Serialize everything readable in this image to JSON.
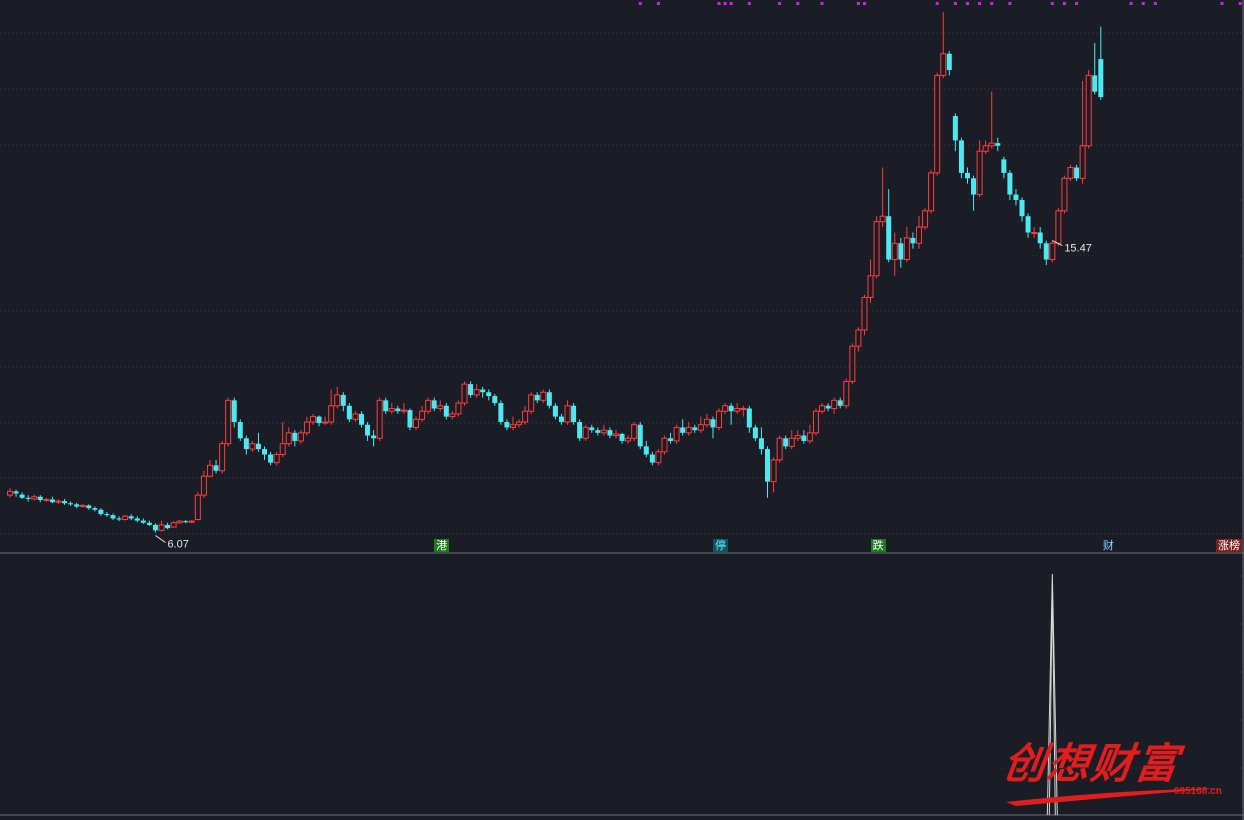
{
  "chart_data": {
    "type": "candlestick",
    "price_axis": {
      "min": 5.5,
      "max": 15.6
    },
    "labels": {
      "low_marker": "6.07",
      "high_marker": "15.47"
    },
    "annotations": [
      {
        "index": 71,
        "text": "港",
        "color": "#ffffff",
        "bg": "#1f7a1f"
      },
      {
        "index": 117,
        "text": "停",
        "color": "#6fe8ff",
        "bg": "#0f5560"
      },
      {
        "index": 143,
        "text": "跌",
        "color": "#ffffff",
        "bg": "#1f7a1f"
      },
      {
        "index": 181,
        "text": "财",
        "color": "#8ad7ff",
        "bg": "#1b1d26"
      },
      {
        "index": 200,
        "text": "涨榜",
        "color": "#ffffff",
        "bg": "#7a1f1f"
      }
    ],
    "top_markers": [
      104,
      107,
      117,
      118,
      119,
      122,
      127,
      130,
      134,
      140,
      141,
      153,
      156,
      158,
      160,
      162,
      165,
      172,
      174,
      176,
      185,
      187,
      189,
      200,
      203
    ],
    "volume_spike_index": 172,
    "colors": {
      "up": "#ff3c3c",
      "down": "#4de8f0",
      "grid": "#3a3d48",
      "marker": "#d21ff0",
      "text": "#e6e6e6",
      "volume": "#d8d8d8"
    },
    "candles": [
      [
        6.55,
        6.62,
        6.68,
        6.5
      ],
      [
        6.62,
        6.58,
        6.65,
        6.52
      ],
      [
        6.56,
        6.5,
        6.6,
        6.48
      ],
      [
        6.5,
        6.48,
        6.55,
        6.43
      ],
      [
        6.48,
        6.52,
        6.56,
        6.45
      ],
      [
        6.52,
        6.46,
        6.55,
        6.42
      ],
      [
        6.46,
        6.47,
        6.5,
        6.43
      ],
      [
        6.47,
        6.42,
        6.52,
        6.4
      ],
      [
        6.42,
        6.44,
        6.47,
        6.39
      ],
      [
        6.44,
        6.4,
        6.48,
        6.37
      ],
      [
        6.4,
        6.38,
        6.43,
        6.35
      ],
      [
        6.38,
        6.34,
        6.41,
        6.31
      ],
      [
        6.34,
        6.36,
        6.39,
        6.32
      ],
      [
        6.36,
        6.31,
        6.38,
        6.28
      ],
      [
        6.31,
        6.28,
        6.34,
        6.25
      ],
      [
        6.28,
        6.2,
        6.31,
        6.17
      ],
      [
        6.2,
        6.18,
        6.24,
        6.15
      ],
      [
        6.18,
        6.12,
        6.21,
        6.09
      ],
      [
        6.12,
        6.1,
        6.16,
        6.07
      ],
      [
        6.1,
        6.16,
        6.19,
        6.08
      ],
      [
        6.16,
        6.12,
        6.2,
        6.09
      ],
      [
        6.12,
        6.08,
        6.16,
        6.05
      ],
      [
        6.08,
        6.04,
        6.12,
        6.02
      ],
      [
        6.04,
        6.0,
        6.08,
        5.98
      ],
      [
        6.0,
        5.9,
        6.03,
        5.86
      ],
      [
        5.9,
        6.0,
        6.08,
        5.88
      ],
      [
        6.0,
        5.94,
        6.04,
        5.92
      ],
      [
        5.96,
        6.04,
        6.07,
        5.95
      ],
      [
        6.04,
        6.07,
        6.09,
        6.02
      ],
      [
        6.07,
        6.05,
        6.09,
        6.03
      ],
      [
        6.05,
        6.07,
        6.09,
        6.03
      ],
      [
        6.1,
        6.55,
        6.6,
        6.08
      ],
      [
        6.55,
        6.9,
        7.0,
        6.5
      ],
      [
        6.9,
        7.1,
        7.2,
        6.88
      ],
      [
        7.1,
        7.0,
        7.2,
        6.95
      ],
      [
        7.0,
        7.5,
        7.55,
        6.95
      ],
      [
        7.5,
        8.3,
        8.35,
        7.45
      ],
      [
        8.3,
        7.9,
        8.35,
        7.8
      ],
      [
        7.9,
        7.6,
        7.95,
        7.55
      ],
      [
        7.6,
        7.4,
        7.65,
        7.3
      ],
      [
        7.4,
        7.5,
        7.55,
        7.35
      ],
      [
        7.5,
        7.4,
        7.7,
        7.35
      ],
      [
        7.4,
        7.3,
        7.45,
        7.2
      ],
      [
        7.3,
        7.15,
        7.35,
        7.1
      ],
      [
        7.15,
        7.3,
        7.35,
        7.1
      ],
      [
        7.3,
        7.5,
        7.9,
        7.25
      ],
      [
        7.5,
        7.7,
        7.8,
        7.45
      ],
      [
        7.7,
        7.55,
        7.75,
        7.45
      ],
      [
        7.55,
        7.7,
        7.75,
        7.5
      ],
      [
        7.7,
        7.9,
        8.0,
        7.65
      ],
      [
        7.9,
        8.0,
        8.05,
        7.85
      ],
      [
        8.0,
        7.88,
        8.02,
        7.82
      ],
      [
        7.88,
        7.9,
        8.0,
        7.85
      ],
      [
        7.9,
        8.2,
        8.5,
        7.85
      ],
      [
        8.2,
        8.4,
        8.55,
        8.15
      ],
      [
        8.4,
        8.2,
        8.45,
        8.1
      ],
      [
        8.2,
        7.95,
        8.25,
        7.9
      ],
      [
        7.95,
        8.05,
        8.1,
        7.9
      ],
      [
        8.05,
        7.85,
        8.1,
        7.8
      ],
      [
        7.85,
        7.65,
        7.9,
        7.55
      ],
      [
        7.65,
        7.6,
        7.75,
        7.45
      ],
      [
        7.6,
        8.3,
        8.35,
        7.55
      ],
      [
        8.3,
        8.1,
        8.35,
        8.05
      ],
      [
        8.1,
        8.15,
        8.25,
        8.05
      ],
      [
        8.15,
        8.1,
        8.2,
        8.05
      ],
      [
        8.1,
        8.12,
        8.25,
        8.05
      ],
      [
        8.12,
        7.8,
        8.15,
        7.75
      ],
      [
        7.8,
        7.95,
        8.0,
        7.75
      ],
      [
        7.95,
        8.1,
        8.2,
        7.9
      ],
      [
        8.1,
        8.3,
        8.35,
        8.05
      ],
      [
        8.3,
        8.15,
        8.35,
        8.1
      ],
      [
        8.15,
        8.2,
        8.3,
        8.1
      ],
      [
        8.2,
        8.0,
        8.25,
        7.95
      ],
      [
        8.0,
        8.05,
        8.1,
        7.95
      ],
      [
        8.05,
        8.25,
        8.3,
        8.0
      ],
      [
        8.25,
        8.6,
        8.65,
        8.2
      ],
      [
        8.6,
        8.4,
        8.65,
        8.35
      ],
      [
        8.4,
        8.5,
        8.6,
        8.35
      ],
      [
        8.5,
        8.45,
        8.55,
        8.35
      ],
      [
        8.45,
        8.38,
        8.5,
        8.3
      ],
      [
        8.38,
        8.25,
        8.42,
        8.2
      ],
      [
        8.25,
        7.9,
        8.3,
        7.85
      ],
      [
        7.9,
        7.8,
        7.95,
        7.75
      ],
      [
        7.8,
        7.85,
        8.0,
        7.75
      ],
      [
        7.85,
        7.9,
        7.95,
        7.8
      ],
      [
        7.9,
        8.1,
        8.2,
        7.85
      ],
      [
        8.1,
        8.4,
        8.45,
        8.05
      ],
      [
        8.4,
        8.3,
        8.45,
        8.25
      ],
      [
        8.3,
        8.45,
        8.5,
        8.25
      ],
      [
        8.45,
        8.2,
        8.5,
        8.15
      ],
      [
        8.2,
        8.0,
        8.25,
        7.95
      ],
      [
        8.0,
        7.9,
        8.05,
        7.85
      ],
      [
        7.9,
        8.2,
        8.3,
        7.85
      ],
      [
        8.2,
        7.9,
        8.25,
        7.85
      ],
      [
        7.9,
        7.6,
        7.95,
        7.55
      ],
      [
        7.6,
        7.8,
        7.85,
        7.55
      ],
      [
        7.8,
        7.75,
        7.85,
        7.7
      ],
      [
        7.75,
        7.7,
        7.8,
        7.65
      ],
      [
        7.7,
        7.75,
        7.85,
        7.65
      ],
      [
        7.75,
        7.65,
        7.8,
        7.6
      ],
      [
        7.65,
        7.68,
        7.75,
        7.6
      ],
      [
        7.68,
        7.55,
        7.7,
        7.5
      ],
      [
        7.55,
        7.6,
        7.65,
        7.5
      ],
      [
        7.6,
        7.85,
        7.9,
        7.55
      ],
      [
        7.85,
        7.45,
        7.9,
        7.4
      ],
      [
        7.45,
        7.3,
        7.55,
        7.25
      ],
      [
        7.3,
        7.15,
        7.35,
        7.1
      ],
      [
        7.15,
        7.35,
        7.4,
        7.1
      ],
      [
        7.35,
        7.6,
        7.65,
        7.3
      ],
      [
        7.6,
        7.55,
        7.7,
        7.5
      ],
      [
        7.55,
        7.8,
        7.85,
        7.5
      ],
      [
        7.8,
        7.7,
        7.95,
        7.65
      ],
      [
        7.7,
        7.8,
        7.9,
        7.65
      ],
      [
        7.8,
        7.75,
        7.85,
        7.7
      ],
      [
        7.75,
        7.85,
        8.0,
        7.7
      ],
      [
        7.85,
        7.95,
        8.05,
        7.8
      ],
      [
        7.95,
        7.8,
        8.0,
        7.6
      ],
      [
        7.8,
        8.1,
        8.15,
        7.75
      ],
      [
        8.1,
        8.2,
        8.25,
        8.05
      ],
      [
        8.2,
        8.1,
        8.25,
        7.85
      ],
      [
        8.1,
        8.15,
        8.25,
        8.05
      ],
      [
        8.15,
        8.15,
        8.2,
        8.0
      ],
      [
        8.15,
        7.8,
        8.2,
        7.7
      ],
      [
        7.8,
        7.6,
        7.85,
        7.55
      ],
      [
        7.6,
        7.4,
        7.8,
        7.3
      ],
      [
        7.4,
        6.8,
        7.45,
        6.5
      ],
      [
        6.8,
        7.2,
        7.25,
        6.6
      ],
      [
        7.2,
        7.6,
        7.65,
        7.15
      ],
      [
        7.6,
        7.45,
        7.65,
        7.4
      ],
      [
        7.45,
        7.6,
        7.75,
        7.4
      ],
      [
        7.6,
        7.65,
        7.75,
        7.55
      ],
      [
        7.65,
        7.55,
        7.75,
        7.5
      ],
      [
        7.55,
        7.7,
        7.85,
        7.5
      ],
      [
        7.7,
        8.1,
        8.15,
        7.65
      ],
      [
        8.1,
        8.2,
        8.25,
        8.05
      ],
      [
        8.2,
        8.15,
        8.25,
        8.1
      ],
      [
        8.15,
        8.3,
        8.35,
        8.05
      ],
      [
        8.3,
        8.2,
        8.35,
        8.15
      ],
      [
        8.2,
        8.65,
        8.7,
        8.15
      ],
      [
        8.65,
        9.3,
        9.35,
        8.6
      ],
      [
        9.3,
        9.6,
        9.65,
        9.2
      ],
      [
        9.6,
        10.2,
        10.25,
        9.5
      ],
      [
        10.2,
        10.6,
        10.9,
        10.1
      ],
      [
        10.6,
        11.6,
        11.7,
        10.55
      ],
      [
        11.6,
        11.7,
        12.6,
        11.5
      ],
      [
        11.7,
        10.9,
        12.2,
        10.85
      ],
      [
        10.9,
        11.2,
        11.4,
        10.6
      ],
      [
        11.2,
        10.9,
        11.3,
        10.75
      ],
      [
        10.9,
        11.3,
        11.5,
        10.85
      ],
      [
        11.3,
        11.2,
        11.4,
        11.1
      ],
      [
        11.2,
        11.5,
        11.7,
        11.1
      ],
      [
        11.5,
        11.8,
        11.85,
        11.45
      ],
      [
        11.8,
        12.5,
        12.55,
        11.75
      ],
      [
        12.5,
        14.3,
        14.35,
        12.45
      ],
      [
        14.3,
        14.7,
        15.47,
        14.25
      ],
      [
        14.7,
        14.4,
        14.75,
        14.3
      ],
      [
        13.55,
        13.1,
        13.6,
        12.9
      ],
      [
        13.1,
        12.5,
        13.15,
        12.4
      ],
      [
        12.5,
        12.4,
        12.6,
        12.3
      ],
      [
        12.4,
        12.1,
        12.45,
        11.8
      ],
      [
        12.1,
        12.9,
        13.1,
        12.05
      ],
      [
        12.9,
        13.0,
        13.1,
        12.85
      ],
      [
        13.0,
        13.05,
        14.0,
        12.95
      ],
      [
        13.05,
        13.0,
        13.15,
        12.9
      ],
      [
        12.75,
        12.5,
        12.8,
        12.4
      ],
      [
        12.5,
        12.1,
        12.55,
        12.0
      ],
      [
        12.1,
        12.0,
        12.2,
        11.9
      ],
      [
        12.0,
        11.7,
        12.05,
        11.6
      ],
      [
        11.7,
        11.4,
        11.75,
        11.3
      ],
      [
        11.4,
        11.4,
        11.5,
        11.3
      ],
      [
        11.4,
        11.2,
        11.5,
        11.1
      ],
      [
        11.2,
        10.9,
        11.25,
        10.8
      ],
      [
        10.9,
        11.2,
        11.25,
        10.85
      ],
      [
        11.2,
        11.8,
        11.85,
        11.15
      ],
      [
        11.8,
        12.4,
        12.45,
        11.75
      ],
      [
        12.4,
        12.6,
        12.65,
        12.35
      ],
      [
        12.6,
        12.4,
        12.65,
        12.35
      ],
      [
        12.4,
        13.0,
        14.2,
        12.3
      ],
      [
        13.0,
        14.3,
        14.4,
        12.95
      ],
      [
        14.3,
        14.0,
        14.9,
        13.95
      ],
      [
        14.6,
        13.9,
        15.2,
        13.85
      ]
    ]
  }
}
